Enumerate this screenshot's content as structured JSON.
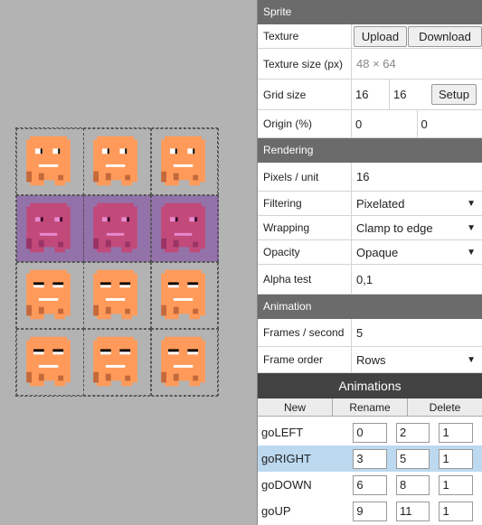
{
  "sprite_section": {
    "title": "Sprite",
    "texture_label": "Texture",
    "upload_label": "Upload",
    "download_label": "Download",
    "texture_size_label": "Texture size (px)",
    "texture_size_value": "48 × 64",
    "grid_size_label": "Grid size",
    "grid_w": "16",
    "grid_h": "16",
    "setup_label": "Setup",
    "origin_label": "Origin (%)",
    "origin_x": "0",
    "origin_y": "0"
  },
  "rendering_section": {
    "title": "Rendering",
    "ppu_label": "Pixels / unit",
    "ppu_value": "16",
    "filtering_label": "Filtering",
    "filtering_value": "Pixelated",
    "wrapping_label": "Wrapping",
    "wrapping_value": "Clamp to edge",
    "opacity_label": "Opacity",
    "opacity_value": "Opaque",
    "alpha_label": "Alpha test",
    "alpha_value": "0,1"
  },
  "animation_section": {
    "title": "Animation",
    "fps_label": "Frames / second",
    "fps_value": "5",
    "order_label": "Frame order",
    "order_value": "Rows"
  },
  "animations": {
    "title": "Animations",
    "new_label": "New",
    "rename_label": "Rename",
    "delete_label": "Delete",
    "items": [
      {
        "name": "goLEFT",
        "start": "0",
        "end": "2",
        "speed": "1"
      },
      {
        "name": "goRIGHT",
        "start": "3",
        "end": "5",
        "speed": "1"
      },
      {
        "name": "goDOWN",
        "start": "6",
        "end": "8",
        "speed": "1"
      },
      {
        "name": "goUP",
        "start": "9",
        "end": "11",
        "speed": "1"
      }
    ]
  },
  "colors": {
    "sprite_orange": "#ff9a5a",
    "sprite_shadow": "#c4693a",
    "selected_row_overlay": "#8c3a8c",
    "selected_animation": "#bcd9f0"
  }
}
